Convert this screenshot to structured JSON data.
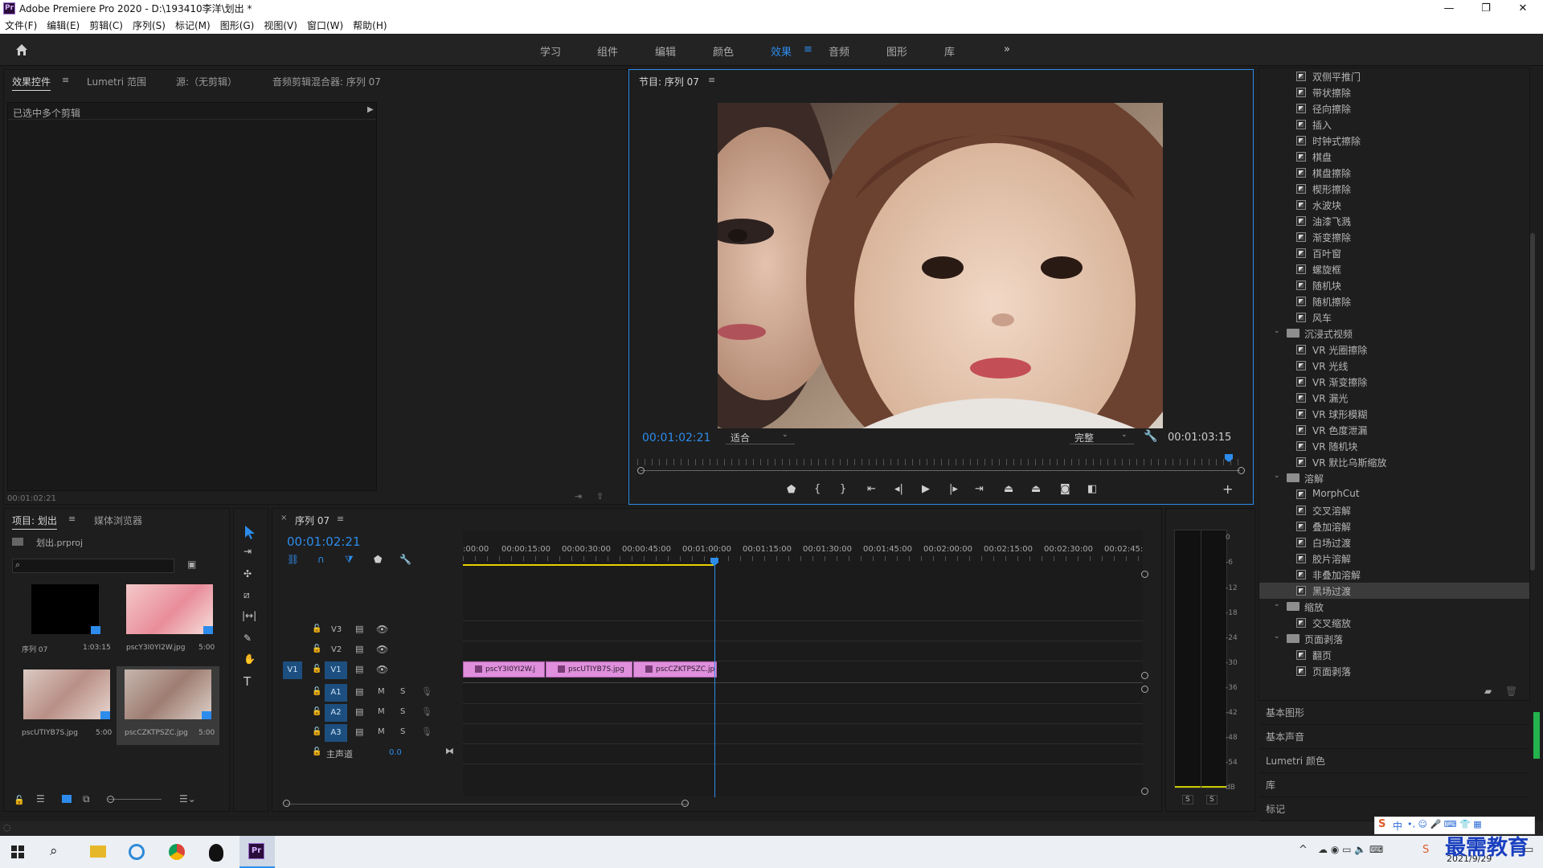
{
  "app": {
    "title": "Adobe Premiere Pro 2020 - D:\\193410李洋\\划出 *",
    "logo": "Pr",
    "window_controls": [
      "—",
      "❐",
      "✕"
    ]
  },
  "menu": [
    "文件(F)",
    "编辑(E)",
    "剪辑(C)",
    "序列(S)",
    "标记(M)",
    "图形(G)",
    "视图(V)",
    "窗口(W)",
    "帮助(H)"
  ],
  "workspaces": {
    "items": [
      "学习",
      "组件",
      "编辑",
      "颜色",
      "效果",
      "音频",
      "图形",
      "库"
    ],
    "active": "效果",
    "more": "»"
  },
  "source_panel": {
    "tabs": [
      "效果控件",
      "Lumetri 范围",
      "源:（无剪辑）",
      "音频剪辑混合器: 序列 07"
    ],
    "selection_text": "已选中多个剪辑",
    "timecode": "00:01:02:21"
  },
  "program_monitor": {
    "title": "节目: 序列 07",
    "current_time": "00:01:02:21",
    "fit": "适合",
    "quality": "完整",
    "duration": "00:01:03:15",
    "playhead_fraction": 0.98
  },
  "project_panel": {
    "tabs": [
      "项目: 划出",
      "媒体浏览器"
    ],
    "project_file": "划出.prproj",
    "search_placeholder": "",
    "items": [
      {
        "name": "序列 07",
        "duration": "1:03:15"
      },
      {
        "name": "pscY3I0YI2W.jpg",
        "duration": "5:00"
      },
      {
        "name": "pscUTIYB7S.jpg",
        "duration": "5:00"
      },
      {
        "name": "pscCZKTPSZC.jpg",
        "duration": "5:00"
      }
    ]
  },
  "timeline": {
    "tab": "序列 07",
    "current_time": "00:01:02:21",
    "ruler": [
      ":00:00",
      "00:00:15:00",
      "00:00:30:00",
      "00:00:45:00",
      "00:01:00:00",
      "00:01:15:00",
      "00:01:30:00",
      "00:01:45:00",
      "00:02:00:00",
      "00:02:15:00",
      "00:02:30:00",
      "00:02:45:"
    ],
    "tracks": {
      "video": [
        "V3",
        "V2",
        "V1"
      ],
      "source_patch": "V1",
      "audio": [
        "A1",
        "A2",
        "A3"
      ],
      "master_label": "主声道",
      "master_value": "0.0",
      "mute": "M",
      "solo": "S"
    },
    "clips": [
      "pscY3I0YI2W.j",
      "pscUTIYB7S.jpg",
      "pscCZKTPSZC.jp"
    ]
  },
  "audio_meter": {
    "scale": [
      "0",
      "-6",
      "-12",
      "-18",
      "-24",
      "-30",
      "-36",
      "-42",
      "-48",
      "-54",
      "dB"
    ],
    "solo_buttons": [
      "S",
      "S"
    ]
  },
  "effects": {
    "rows": [
      {
        "type": "item",
        "label": "双侧平推门"
      },
      {
        "type": "item",
        "label": "带状擦除"
      },
      {
        "type": "item",
        "label": "径向擦除"
      },
      {
        "type": "item",
        "label": "插入"
      },
      {
        "type": "item",
        "label": "时钟式擦除"
      },
      {
        "type": "item",
        "label": "棋盘"
      },
      {
        "type": "item",
        "label": "棋盘擦除"
      },
      {
        "type": "item",
        "label": "楔形擦除"
      },
      {
        "type": "item",
        "label": "水波块"
      },
      {
        "type": "item",
        "label": "油漆飞溅"
      },
      {
        "type": "item",
        "label": "渐变擦除"
      },
      {
        "type": "item",
        "label": "百叶窗"
      },
      {
        "type": "item",
        "label": "螺旋框"
      },
      {
        "type": "item",
        "label": "随机块"
      },
      {
        "type": "item",
        "label": "随机擦除"
      },
      {
        "type": "item",
        "label": "风车"
      },
      {
        "type": "folder",
        "label": "沉浸式视频"
      },
      {
        "type": "item",
        "label": "VR 光圈擦除"
      },
      {
        "type": "item",
        "label": "VR 光线"
      },
      {
        "type": "item",
        "label": "VR 渐变擦除"
      },
      {
        "type": "item",
        "label": "VR 漏光"
      },
      {
        "type": "item",
        "label": "VR 球形模糊"
      },
      {
        "type": "item",
        "label": "VR 色度泄漏"
      },
      {
        "type": "item",
        "label": "VR 随机块"
      },
      {
        "type": "item",
        "label": "VR 默比乌斯缩放"
      },
      {
        "type": "folder",
        "label": "溶解"
      },
      {
        "type": "item",
        "label": "MorphCut"
      },
      {
        "type": "item",
        "label": "交叉溶解"
      },
      {
        "type": "item",
        "label": "叠加溶解"
      },
      {
        "type": "item",
        "label": "白场过渡"
      },
      {
        "type": "item",
        "label": "胶片溶解"
      },
      {
        "type": "item",
        "label": "非叠加溶解"
      },
      {
        "type": "item",
        "label": "黑场过渡",
        "selected": true
      },
      {
        "type": "folder",
        "label": "缩放"
      },
      {
        "type": "item",
        "label": "交叉缩放"
      },
      {
        "type": "folder",
        "label": "页面剥落"
      },
      {
        "type": "item",
        "label": "翻页"
      },
      {
        "type": "item",
        "label": "页面剥落"
      }
    ],
    "other_panels": [
      "基本图形",
      "基本声音",
      "Lumetri 颜色",
      "库",
      "标记"
    ]
  },
  "taskbar": {
    "date": "2021/9/29",
    "ime": "中",
    "watermark": "最需教育"
  },
  "colors": {
    "accent": "#2d8ceb",
    "clip": "#df8fdc",
    "playhead": "#2d8ceb",
    "work_area": "#e8d200"
  }
}
